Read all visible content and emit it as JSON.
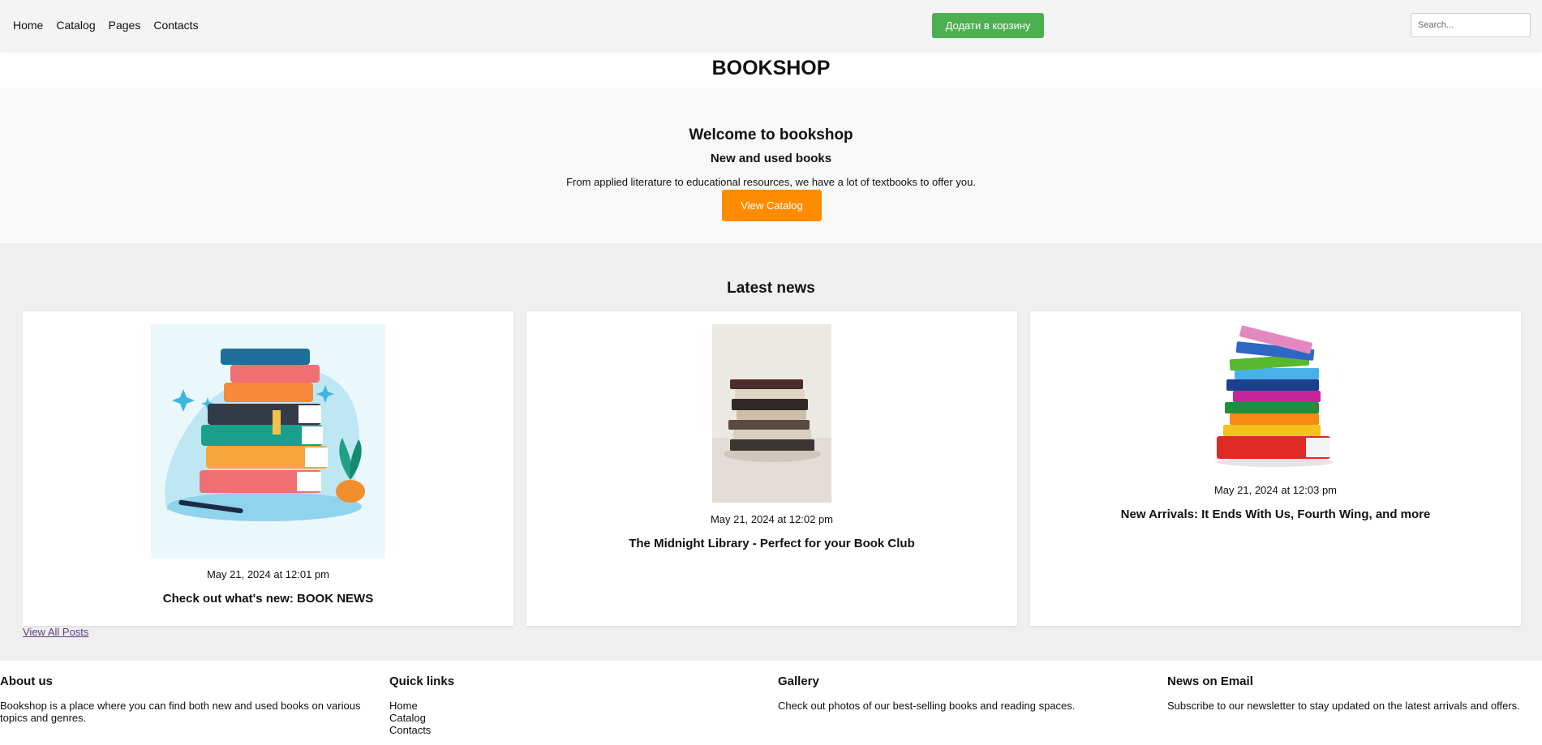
{
  "header": {
    "nav": [
      "Home",
      "Catalog",
      "Pages",
      "Contacts"
    ],
    "cart_button": "Додати в корзину",
    "search_placeholder": "Search..."
  },
  "site_title": "BOOKSHOP",
  "hero": {
    "title": "Welcome to bookshop",
    "subtitle": "New and used books",
    "text": "From applied literature to educational resources, we have a lot of textbooks to offer you.",
    "button": "View Catalog"
  },
  "news": {
    "heading": "Latest news",
    "posts": [
      {
        "date": "May 21, 2024 at 12:01 pm",
        "title": "Check out what's new: BOOK NEWS"
      },
      {
        "date": "May 21, 2024 at 12:02 pm",
        "title": "The Midnight Library - Perfect for your Book Club"
      },
      {
        "date": "May 21, 2024 at 12:03 pm",
        "title": "New Arrivals: It Ends With Us, Fourth Wing, and more"
      }
    ],
    "view_all": "View All Posts"
  },
  "footer": {
    "about": {
      "heading": "About us",
      "text": "Bookshop is a place where you can find both new and used books on various topics and genres."
    },
    "quick_links": {
      "heading": "Quick links",
      "links": [
        "Home",
        "Catalog",
        "Contacts"
      ]
    },
    "gallery": {
      "heading": "Gallery",
      "text": "Check out photos of our best-selling books and reading spaces."
    },
    "newsletter": {
      "heading": "News on Email",
      "text": "Subscribe to our newsletter to stay updated on the latest arrivals and offers."
    }
  }
}
